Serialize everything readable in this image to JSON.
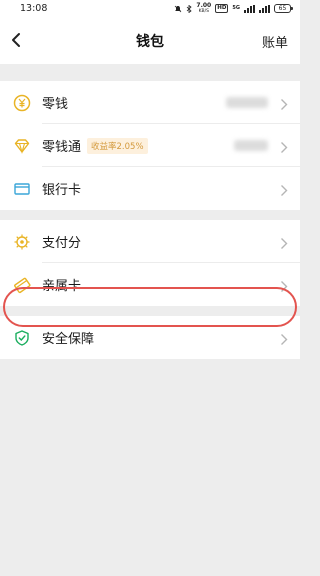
{
  "status_bar": {
    "time": "13:08",
    "speed_value": "7.00",
    "speed_unit": "KB/S",
    "hd": "HD",
    "network": "5G",
    "battery": "65"
  },
  "header": {
    "title": "钱包",
    "right_action": "账单"
  },
  "groups": [
    {
      "items": [
        {
          "label": "零钱"
        },
        {
          "label": "零钱通",
          "tag": "收益率2.05%"
        },
        {
          "label": "银行卡"
        }
      ]
    },
    {
      "items": [
        {
          "label": "支付分"
        },
        {
          "label": "亲属卡"
        }
      ]
    },
    {
      "items": [
        {
          "label": "安全保障"
        }
      ]
    }
  ],
  "colors": {
    "icon_gold": "#e9b426",
    "icon_blue": "#3aa6d8",
    "icon_green": "#1aad5e",
    "highlight": "#e3544f"
  }
}
